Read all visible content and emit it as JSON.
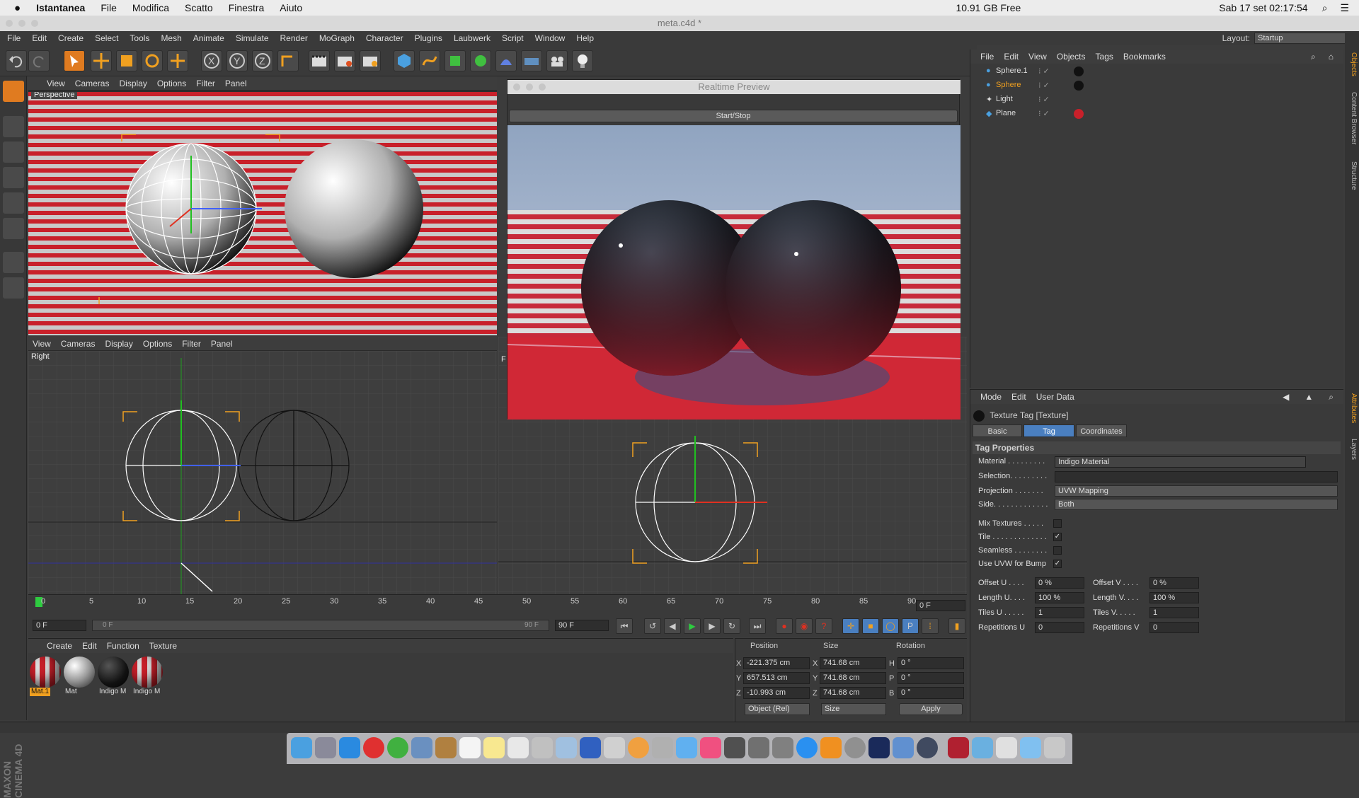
{
  "mac_menubar": {
    "app": "Istantanea",
    "items": [
      "File",
      "Modifica",
      "Scatto",
      "Finestra",
      "Aiuto"
    ],
    "memory": "10.91 GB Free",
    "datetime": "Sab 17 set  02:17:54"
  },
  "window_title": "meta.c4d *",
  "menu": [
    "File",
    "Edit",
    "Create",
    "Select",
    "Tools",
    "Mesh",
    "Animate",
    "Simulate",
    "Render",
    "MoGraph",
    "Character",
    "Plugins",
    "Laubwerk",
    "Script",
    "Window",
    "Help"
  ],
  "layout": {
    "label": "Layout:",
    "value": "Startup"
  },
  "viewport_menu": [
    "View",
    "Cameras",
    "Display",
    "Options",
    "Filter",
    "Panel"
  ],
  "viewport_top_label": "Perspective",
  "viewport_bottom_label": "Right",
  "viewport_front_label": "F",
  "preview": {
    "title": "Realtime Preview",
    "button": "Start/Stop"
  },
  "objects_menu": [
    "File",
    "Edit",
    "View",
    "Objects",
    "Tags",
    "Bookmarks"
  ],
  "objects": [
    {
      "name": "Sphere.1",
      "color": "#dddddd"
    },
    {
      "name": "Sphere",
      "color": "#f0a020"
    },
    {
      "name": "Light",
      "color": "#dddddd"
    },
    {
      "name": "Plane",
      "color": "#dddddd"
    }
  ],
  "attributes_menu": [
    "Mode",
    "Edit",
    "User Data"
  ],
  "attr_title": "Texture Tag [Texture]",
  "attr_tabs": [
    "Basic",
    "Tag",
    "Coordinates"
  ],
  "tag_props": {
    "heading": "Tag Properties",
    "material_label": "Material . . . . . . . . .",
    "material": "Indigo Material",
    "selection_label": "Selection. . . . . . . . .",
    "projection_label": "Projection . . . . . . .",
    "projection": "UVW Mapping",
    "side_label": "Side. . . . . . . . . . . . .",
    "side": "Both",
    "mix_label": "Mix Textures . . . . .",
    "tile_label": "Tile . . . . . . . . . . . . .",
    "seamless_label": "Seamless . . . . . . . .",
    "uvw_label": "Use UVW for Bump",
    "offset_u_label": "Offset U . . . .",
    "offset_u": "0 %",
    "offset_v_label": "Offset V . . . .",
    "offset_v": "0 %",
    "length_u_label": "Length U. . . .",
    "length_u": "100 %",
    "length_v_label": "Length V. . . .",
    "length_v": "100 %",
    "tiles_u_label": "Tiles U . . . . .",
    "tiles_u": "1",
    "tiles_v_label": "Tiles V. . . . .",
    "tiles_v": "1",
    "rep_u_label": "Repetitions U",
    "rep_u": "0",
    "rep_v_label": "Repetitions V",
    "rep_v": "0"
  },
  "timeline": {
    "ticks": [
      "0",
      "5",
      "10",
      "15",
      "20",
      "25",
      "30",
      "35",
      "40",
      "45",
      "50",
      "55",
      "60",
      "65",
      "70",
      "75",
      "80",
      "85",
      "90"
    ],
    "current": "0 F",
    "start": "0 F",
    "range_start": "0 F",
    "range_end": "90 F",
    "end": "90 F"
  },
  "materials_menu": [
    "Create",
    "Edit",
    "Function",
    "Texture"
  ],
  "materials": [
    {
      "name": "Mat.1"
    },
    {
      "name": "Mat"
    },
    {
      "name": "Indigo M"
    },
    {
      "name": "Indigo M"
    }
  ],
  "coords": {
    "headers": [
      "Position",
      "Size",
      "Rotation"
    ],
    "pos": [
      "-221.375 cm",
      "657.513 cm",
      "-10.993 cm"
    ],
    "size": [
      "741.68 cm",
      "741.68 cm",
      "741.68 cm"
    ],
    "rot": [
      "0 °",
      "0 °",
      "0 °"
    ],
    "axes": [
      "X",
      "Y",
      "Z"
    ],
    "rot_axes": [
      "H",
      "P",
      "B"
    ],
    "mode": "Object (Rel)",
    "size_mode": "Size",
    "apply": "Apply"
  },
  "side_tabs": [
    "Objects",
    "Content Browser",
    "Structure",
    "Attributes",
    "Layers"
  ],
  "brand": "MAXON CINEMA 4D"
}
